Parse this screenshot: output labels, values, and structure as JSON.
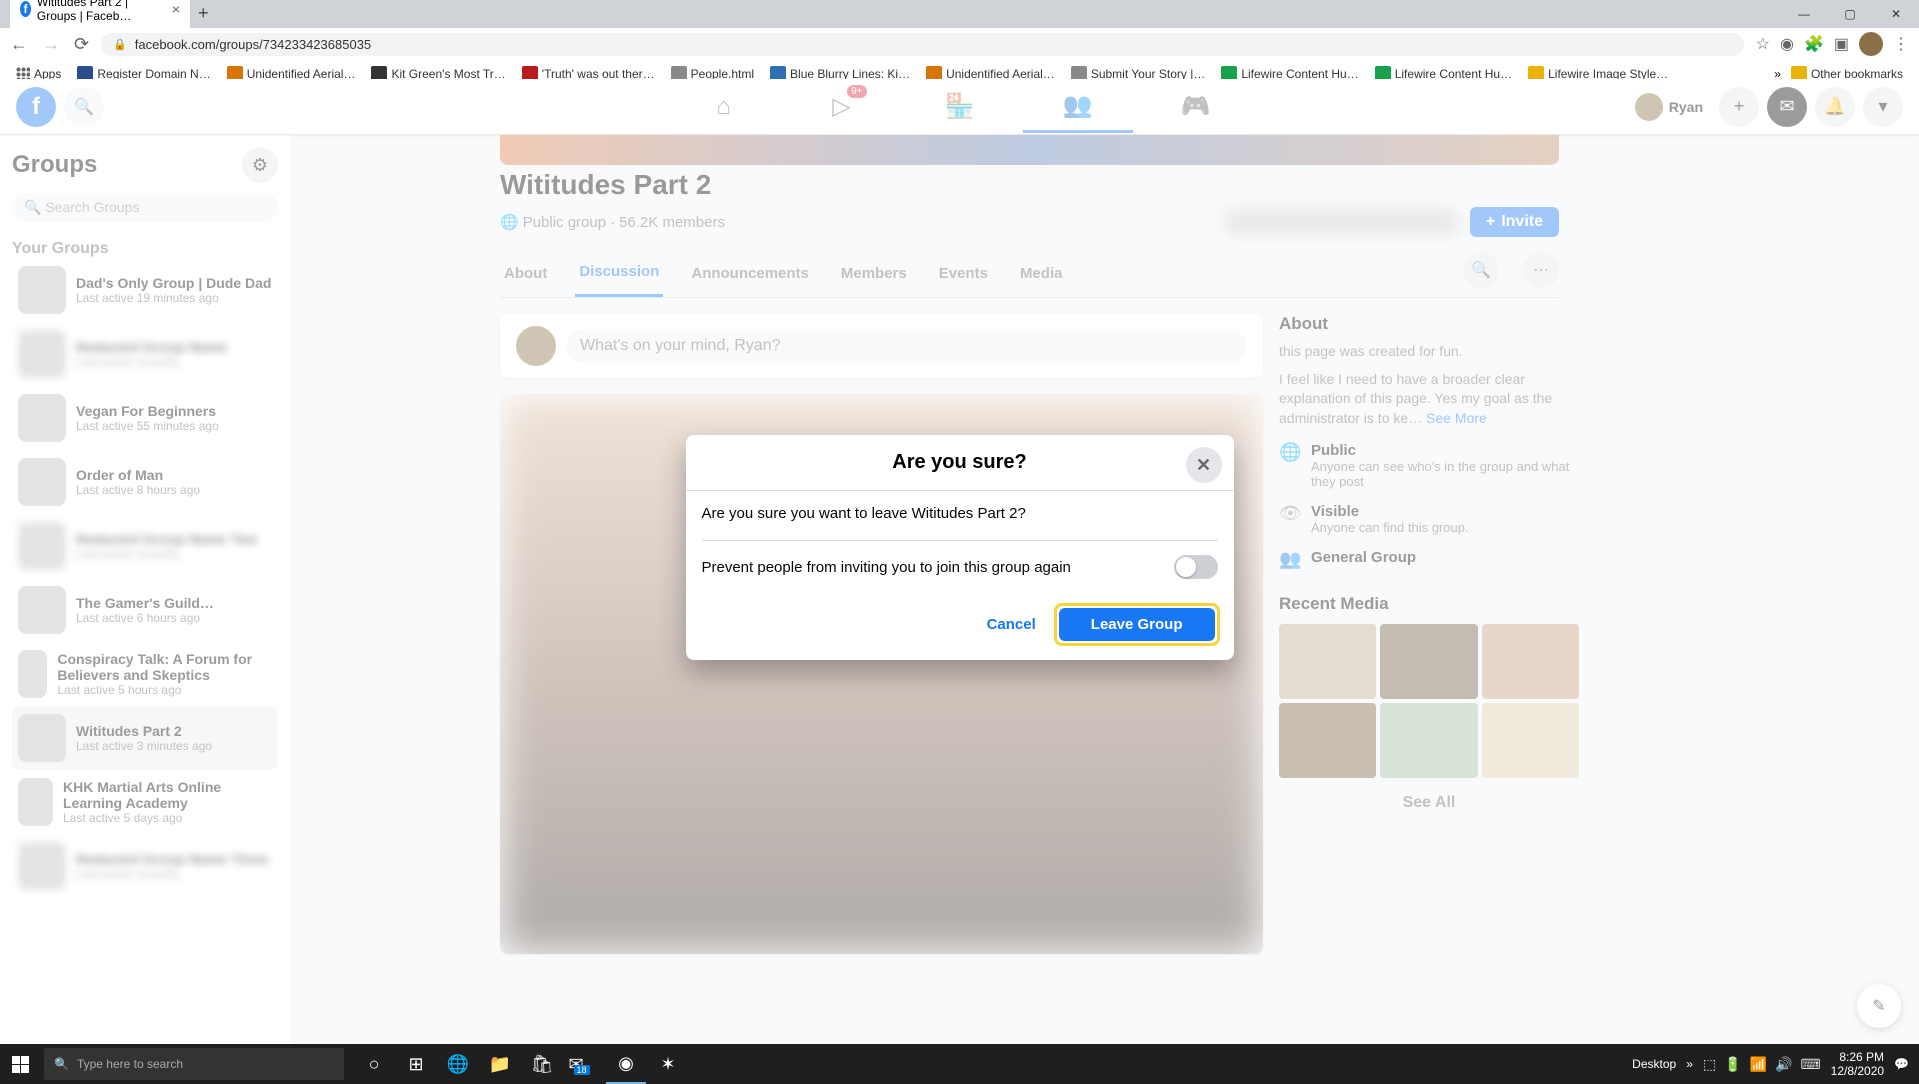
{
  "browser": {
    "tab_title": "Wititudes Part 2 | Groups | Faceb…",
    "url": "facebook.com/groups/734233423685035",
    "bookmarks": [
      {
        "label": "Apps"
      },
      {
        "label": "Register Domain N…"
      },
      {
        "label": "Unidentified Aerial…"
      },
      {
        "label": "Kit Green's Most Tr…"
      },
      {
        "label": "'Truth' was out ther…"
      },
      {
        "label": "People.html"
      },
      {
        "label": "Blue Blurry Lines: Ki…"
      },
      {
        "label": "Unidentified Aerial…"
      },
      {
        "label": "Submit Your Story |…"
      },
      {
        "label": "Lifewire Content Hu…"
      },
      {
        "label": "Lifewire Content Hu…"
      },
      {
        "label": "Lifewire Image Style…"
      }
    ],
    "other_bookmarks": "Other bookmarks"
  },
  "fb_header": {
    "profile_name": "Ryan",
    "watch_badge": "9+"
  },
  "sidebar": {
    "title": "Groups",
    "search_placeholder": "Search Groups",
    "section": "Your Groups",
    "groups": [
      {
        "name": "Dad's Only Group | Dude Dad",
        "sub": "Last active 19 minutes ago",
        "blur": false
      },
      {
        "name": "Redacted Group Name",
        "sub": "Last active recently",
        "blur": true
      },
      {
        "name": "Vegan For Beginners",
        "sub": "Last active 55 minutes ago",
        "blur": false
      },
      {
        "name": "Order of Man",
        "sub": "Last active 8 hours ago",
        "blur": false
      },
      {
        "name": "Redacted Group Name Two",
        "sub": "Last active recently",
        "blur": true
      },
      {
        "name": "The Gamer's Guild…",
        "sub": "Last active 6 hours ago",
        "blur": false
      },
      {
        "name": "Conspiracy Talk: A Forum for Believers and Skeptics",
        "sub": "Last active 5 hours ago",
        "blur": false
      },
      {
        "name": "Wititudes Part 2",
        "sub": "Last active 3 minutes ago",
        "blur": false,
        "selected": true
      },
      {
        "name": "KHK Martial Arts Online Learning Academy",
        "sub": "Last active 5 days ago",
        "blur": false
      },
      {
        "name": "Redacted Group Name Three",
        "sub": "Last active recently",
        "blur": true
      }
    ]
  },
  "group": {
    "title": "Wititudes Part 2",
    "visibility": "Public group",
    "members": "56.2K members",
    "invite": "Invite",
    "tabs": [
      "About",
      "Discussion",
      "Announcements",
      "Members",
      "Events",
      "Media"
    ],
    "active_tab": "Discussion",
    "composer_placeholder": "What's on your mind, Ryan?",
    "about_heading": "About",
    "about_text1": "this page was created for fun.",
    "about_text2": "I feel like I need to have a broader clear explanation of this page. Yes my goal as the administrator is to ke… ",
    "see_more": "See More",
    "info": [
      {
        "icon": "globe",
        "title": "Public",
        "sub": "Anyone can see who's in the group and what they post"
      },
      {
        "icon": "eye",
        "title": "Visible",
        "sub": "Anyone can find this group."
      },
      {
        "icon": "users",
        "title": "General Group",
        "sub": ""
      }
    ],
    "recent_media": "Recent Media",
    "see_all": "See All"
  },
  "modal": {
    "title": "Are you sure?",
    "body": "Are you sure you want to leave Wititudes Part 2?",
    "prevent": "Prevent people from inviting you to join this group again",
    "cancel": "Cancel",
    "leave": "Leave Group"
  },
  "taskbar": {
    "search_placeholder": "Type here to search",
    "desktop": "Desktop",
    "time": "8:26 PM",
    "date": "12/8/2020",
    "mail_badge": "18"
  }
}
